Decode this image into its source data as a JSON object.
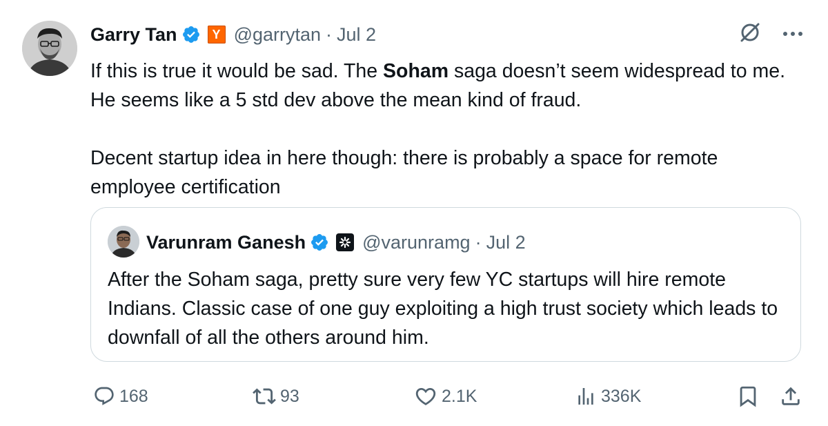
{
  "tweet": {
    "author_name": "Garry Tan",
    "handle": "@garrytan",
    "separator": "·",
    "date": "Jul 2",
    "affiliation_badge": "Y",
    "text_p1_a": "If this is true it would be sad. The ",
    "text_p1_bold": "Soham",
    "text_p1_b": " saga doesn’t seem widespread to me. He seems like a 5 std dev above the mean kind of fraud.",
    "text_p2": "Decent startup idea in here though: there is probably a space for remote employee certification"
  },
  "quoted": {
    "author_name": "Varunram Ganesh",
    "handle": "@varunramg",
    "separator": "·",
    "date": "Jul 2",
    "text": "After the Soham saga, pretty sure very few YC startups will hire remote Indians. Classic case of one guy exploiting a high trust society which leads to downfall of all the others around him."
  },
  "actions": {
    "replies": "168",
    "reposts": "93",
    "likes": "2.1K",
    "views": "336K"
  },
  "icons": {
    "verified": "verified-badge-icon",
    "grok": "grok-icon",
    "more": "more-icon",
    "reply": "reply-icon",
    "repost": "repost-icon",
    "like": "heart-icon",
    "views": "views-icon",
    "bookmark": "bookmark-icon",
    "share": "share-icon"
  },
  "colors": {
    "verified": "#1d9bf0",
    "yc_orange": "#ff6600",
    "secondary_text": "#536471",
    "border": "#cfd9de"
  }
}
